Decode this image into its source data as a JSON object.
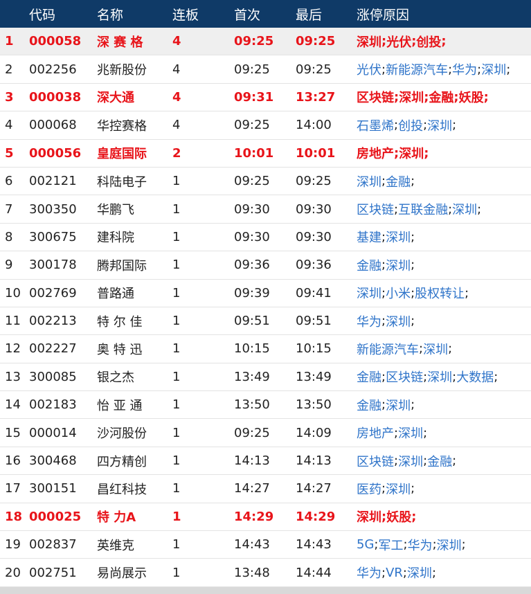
{
  "colors": {
    "header_bg": "#0f3a67",
    "highlight_text": "#e8141a",
    "link": "#2f74c9",
    "row_shade": "#efefef"
  },
  "headers": {
    "code": "代码",
    "name": "名称",
    "lianban": "连板",
    "first": "首次",
    "last": "最后",
    "reason": "涨停原因"
  },
  "rows": [
    {
      "no": "1",
      "code": "000058",
      "name": "深 赛 格",
      "lianban": "4",
      "first": "09:25",
      "last": "09:25",
      "tags": [
        "深圳",
        "光伏",
        "创投"
      ],
      "hot": true,
      "shade": true
    },
    {
      "no": "2",
      "code": "002256",
      "name": "兆新股份",
      "lianban": "4",
      "first": "09:25",
      "last": "09:25",
      "tags": [
        "光伏",
        "新能源汽车",
        "华为",
        "深圳"
      ],
      "hot": false,
      "shade": false
    },
    {
      "no": "3",
      "code": "000038",
      "name": "深大通",
      "lianban": "4",
      "first": "09:31",
      "last": "13:27",
      "tags": [
        "区块链",
        "深圳",
        "金融",
        "妖股"
      ],
      "hot": true,
      "shade": false
    },
    {
      "no": "4",
      "code": "000068",
      "name": "华控赛格",
      "lianban": "4",
      "first": "09:25",
      "last": "14:00",
      "tags": [
        "石墨烯",
        "创投",
        "深圳"
      ],
      "hot": false,
      "shade": false
    },
    {
      "no": "5",
      "code": "000056",
      "name": "皇庭国际",
      "lianban": "2",
      "first": "10:01",
      "last": "10:01",
      "tags": [
        "房地产",
        "深圳"
      ],
      "hot": true,
      "shade": false
    },
    {
      "no": "6",
      "code": "002121",
      "name": "科陆电子",
      "lianban": "1",
      "first": "09:25",
      "last": "09:25",
      "tags": [
        "深圳",
        "金融"
      ],
      "hot": false,
      "shade": false
    },
    {
      "no": "7",
      "code": "300350",
      "name": "华鹏飞",
      "lianban": "1",
      "first": "09:30",
      "last": "09:30",
      "tags": [
        "区块链",
        "互联金融",
        "深圳"
      ],
      "hot": false,
      "shade": false
    },
    {
      "no": "8",
      "code": "300675",
      "name": "建科院",
      "lianban": "1",
      "first": "09:30",
      "last": "09:30",
      "tags": [
        "基建",
        "深圳"
      ],
      "hot": false,
      "shade": false
    },
    {
      "no": "9",
      "code": "300178",
      "name": "腾邦国际",
      "lianban": "1",
      "first": "09:36",
      "last": "09:36",
      "tags": [
        "金融",
        "深圳"
      ],
      "hot": false,
      "shade": false
    },
    {
      "no": "10",
      "code": "002769",
      "name": "普路通",
      "lianban": "1",
      "first": "09:39",
      "last": "09:41",
      "tags": [
        "深圳",
        "小米",
        "股权转让"
      ],
      "hot": false,
      "shade": false
    },
    {
      "no": "11",
      "code": "002213",
      "name": "特 尔 佳",
      "lianban": "1",
      "first": "09:51",
      "last": "09:51",
      "tags": [
        "华为",
        "深圳"
      ],
      "hot": false,
      "shade": false
    },
    {
      "no": "12",
      "code": "002227",
      "name": "奥 特 迅",
      "lianban": "1",
      "first": "10:15",
      "last": "10:15",
      "tags": [
        "新能源汽车",
        "深圳"
      ],
      "hot": false,
      "shade": false
    },
    {
      "no": "13",
      "code": "300085",
      "name": "银之杰",
      "lianban": "1",
      "first": "13:49",
      "last": "13:49",
      "tags": [
        "金融",
        "区块链",
        "深圳",
        "大数据"
      ],
      "hot": false,
      "shade": false
    },
    {
      "no": "14",
      "code": "002183",
      "name": "怡 亚 通",
      "lianban": "1",
      "first": "13:50",
      "last": "13:50",
      "tags": [
        "金融",
        "深圳"
      ],
      "hot": false,
      "shade": false
    },
    {
      "no": "15",
      "code": "000014",
      "name": "沙河股份",
      "lianban": "1",
      "first": "09:25",
      "last": "14:09",
      "tags": [
        "房地产",
        "深圳"
      ],
      "hot": false,
      "shade": false
    },
    {
      "no": "16",
      "code": "300468",
      "name": "四方精创",
      "lianban": "1",
      "first": "14:13",
      "last": "14:13",
      "tags": [
        "区块链",
        "深圳",
        "金融"
      ],
      "hot": false,
      "shade": false
    },
    {
      "no": "17",
      "code": "300151",
      "name": "昌红科技",
      "lianban": "1",
      "first": "14:27",
      "last": "14:27",
      "tags": [
        "医药",
        "深圳"
      ],
      "hot": false,
      "shade": false
    },
    {
      "no": "18",
      "code": "000025",
      "name": "特 力A",
      "lianban": "1",
      "first": "14:29",
      "last": "14:29",
      "tags": [
        "深圳",
        "妖股"
      ],
      "hot": true,
      "shade": false
    },
    {
      "no": "19",
      "code": "002837",
      "name": "英维克",
      "lianban": "1",
      "first": "14:43",
      "last": "14:43",
      "tags": [
        "5G",
        "军工",
        "华为",
        "深圳"
      ],
      "hot": false,
      "shade": false
    },
    {
      "no": "20",
      "code": "002751",
      "name": "易尚展示",
      "lianban": "1",
      "first": "13:48",
      "last": "14:44",
      "tags": [
        "华为",
        "VR",
        "深圳"
      ],
      "hot": false,
      "shade": false
    }
  ]
}
